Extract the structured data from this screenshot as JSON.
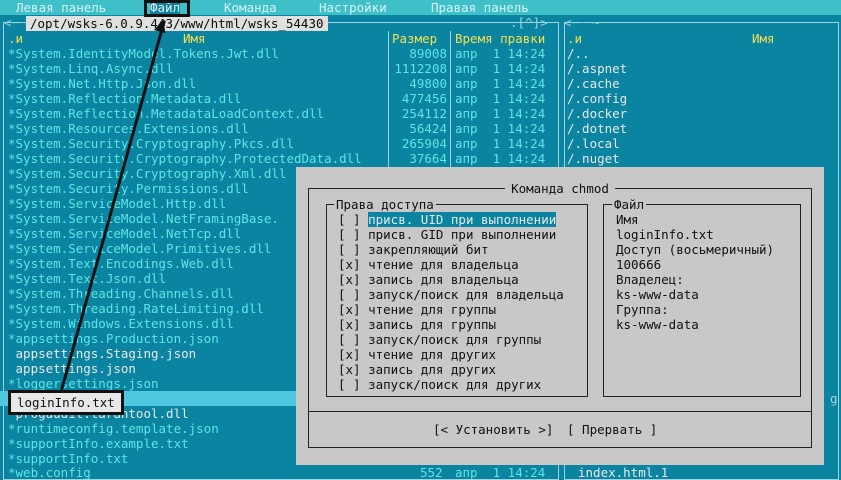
{
  "menubar": {
    "items": [
      "Левая панель",
      "Файл",
      "Команда",
      "Настройки",
      "Правая панель"
    ]
  },
  "left_panel": {
    "path": "/opt/wsks-6.0.9.443/www/html/wsks_54430",
    "history_marker": ".[^]>",
    "headers": {
      "sort": ".и",
      "name": "Имя",
      "size": "Размер",
      "mtime": "Время правки"
    },
    "files": [
      {
        "name": "*System.IdentityModel.Tokens.Jwt.dll",
        "size": "89008",
        "date": "апр  1 14:24"
      },
      {
        "name": "*System.Linq.Async.dll",
        "size": "1112208",
        "date": "апр  1 14:24"
      },
      {
        "name": "*System.Net.Http.Json.dll",
        "size": "49800",
        "date": "апр  1 14:24"
      },
      {
        "name": "*System.Reflection.Metadata.dll",
        "size": "477456",
        "date": "апр  1 14:24"
      },
      {
        "name": "*System.Reflection.MetadataLoadContext.dll",
        "size": "254112",
        "date": "апр  1 14:24"
      },
      {
        "name": "*System.Resources.Extensions.dll",
        "size": "56424",
        "date": "апр  1 14:24"
      },
      {
        "name": "*System.Security.Cryptography.Pkcs.dll",
        "size": "265904",
        "date": "апр  1 14:24"
      },
      {
        "name": "*System.Security.Cryptography.ProtectedData.dll",
        "size": "37664",
        "date": "апр  1 14:24"
      },
      {
        "name": "*System.Security.Cryptography.Xml.dll",
        "size": "",
        "date": ""
      },
      {
        "name": "*System.Security.Permissions.dll",
        "size": "",
        "date": ""
      },
      {
        "name": "*System.ServiceModel.Http.dll",
        "size": "",
        "date": ""
      },
      {
        "name": "*System.ServiceModel.NetFramingBase.",
        "size": "",
        "date": ""
      },
      {
        "name": "*System.ServiceModel.NetTcp.dll",
        "size": "",
        "date": ""
      },
      {
        "name": "*System.ServiceModel.Primitives.dll",
        "size": "",
        "date": ""
      },
      {
        "name": "*System.Text.Encodings.Web.dll",
        "size": "",
        "date": ""
      },
      {
        "name": "*System.Text.Json.dll",
        "size": "",
        "date": ""
      },
      {
        "name": "*System.Threading.Channels.dll",
        "size": "",
        "date": ""
      },
      {
        "name": "*System.Threading.RateLimiting.dll",
        "size": "",
        "date": ""
      },
      {
        "name": "*System.Windows.Extensions.dll",
        "size": "",
        "date": ""
      },
      {
        "name": "*appsettings.Production.json",
        "size": "",
        "date": ""
      },
      {
        "name": " appsettings.Staging.json",
        "size": "",
        "date": ""
      },
      {
        "name": " appsettings.json",
        "size": "",
        "date": ""
      },
      {
        "name": "*loggersettings.json",
        "size": "",
        "date": ""
      },
      {
        "name": " loginInfo.txt",
        "size": "",
        "date": ""
      },
      {
        "name": " progaudit.tarantool.dll",
        "size": "",
        "date": ""
      },
      {
        "name": "*runtimeconfig.template.json",
        "size": "",
        "date": ""
      },
      {
        "name": "*supportInfo.example.txt",
        "size": "",
        "date": ""
      },
      {
        "name": "*supportInfo.txt",
        "size": "",
        "date": ""
      },
      {
        "name": "*web.config",
        "size": "552",
        "date": "апр  1 14:24"
      }
    ],
    "selected_file": "loginInfo.txt"
  },
  "right_panel": {
    "path": "~",
    "headers": {
      "sort": ".и",
      "name": "Имя"
    },
    "items": [
      "/..",
      "/.aspnet",
      "/.cache",
      "/.config",
      "/.docker",
      "/.dotnet",
      "/.local",
      "/.nuget"
    ],
    "bottom_item": "index.html.1",
    "edge_char": "g"
  },
  "chmod_dialog": {
    "title": "Команда chmod",
    "permissions_label": "Права доступа",
    "permissions": [
      {
        "mark": "[ ]",
        "label": "присв. UID при выполнении"
      },
      {
        "mark": "[ ]",
        "label": "присв. GID при выполнении"
      },
      {
        "mark": "[ ]",
        "label": "закрепляющий бит"
      },
      {
        "mark": "[x]",
        "label": "чтение для владельца"
      },
      {
        "mark": "[x]",
        "label": "запись для владельца"
      },
      {
        "mark": "[ ]",
        "label": "запуск/поиск для владельца"
      },
      {
        "mark": "[x]",
        "label": "чтение для группы"
      },
      {
        "mark": "[x]",
        "label": "запись для группы"
      },
      {
        "mark": "[ ]",
        "label": "запуск/поиск для группы"
      },
      {
        "mark": "[x]",
        "label": "чтение для других"
      },
      {
        "mark": "[x]",
        "label": "запись для других"
      },
      {
        "mark": "[ ]",
        "label": "запуск/поиск для других"
      }
    ],
    "file_label": "Файл",
    "file_info": {
      "name_label": "Имя",
      "name": "loginInfo.txt",
      "mode_label": "Доступ (восьмеричный)",
      "mode": "100666",
      "owner_label": "Владелец:",
      "owner": "ks-www-data",
      "group_label": "Группа:",
      "group": "ks-www-data"
    },
    "set_button": "[< Установить >]",
    "cancel_button": "[ Прервать ]"
  }
}
